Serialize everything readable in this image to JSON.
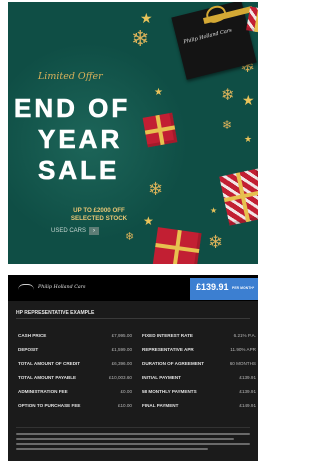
{
  "promo": {
    "tagline": "Limited Offer",
    "headline_1": "END OF",
    "headline_2": "YEAR",
    "headline_3": "SALE",
    "offer_line_1": "UP TO £2000 OFF",
    "offer_line_2": "SELECTED STOCK",
    "cta_label": "USED CARS",
    "cta_arrow": "›",
    "giftbox_brand": "Philip Holland Cars",
    "colors": {
      "background": "#0f4e45",
      "gold": "#d9b15a",
      "red": "#c21f33"
    }
  },
  "finance": {
    "brand": "Philip Holland Cars",
    "monthly_price": "£139.91",
    "per_month_label": "PER MONTH*",
    "section_title": "HP REPRESENTATIVE EXAMPLE",
    "left_rows": [
      {
        "label": "CASH PRICE",
        "value": "£7,995.00"
      },
      {
        "label": "DEPOSIT",
        "value": "£1,599.00"
      },
      {
        "label": "TOTAL AMOUNT OF CREDIT",
        "value": "£6,396.00"
      },
      {
        "label": "TOTAL AMOUNT PAYABLE",
        "value": "£10,003.60"
      },
      {
        "label": "ADMINISTRATION FEE",
        "value": "£0.00"
      },
      {
        "label": "OPTION TO PURCHASE FEE",
        "value": "£10.00"
      }
    ],
    "right_rows": [
      {
        "label": "FIXED INTEREST RATE",
        "value": "6.21% P.A."
      },
      {
        "label": "REPRESENTATIVE APR",
        "value": "11.90% APR"
      },
      {
        "label": "DURATION OF AGREEMENT",
        "value": "60 MONTHS"
      },
      {
        "label": "INITIAL PAYMENT",
        "value": "£139.91"
      },
      {
        "label": "58 MONTHLY PAYMENTS",
        "value": "£139.91"
      },
      {
        "label": "FINAL PAYMENT",
        "value": "£149.91"
      }
    ],
    "colors": {
      "price_tag": "#3c7fd1",
      "card": "#1b1b1b"
    }
  }
}
